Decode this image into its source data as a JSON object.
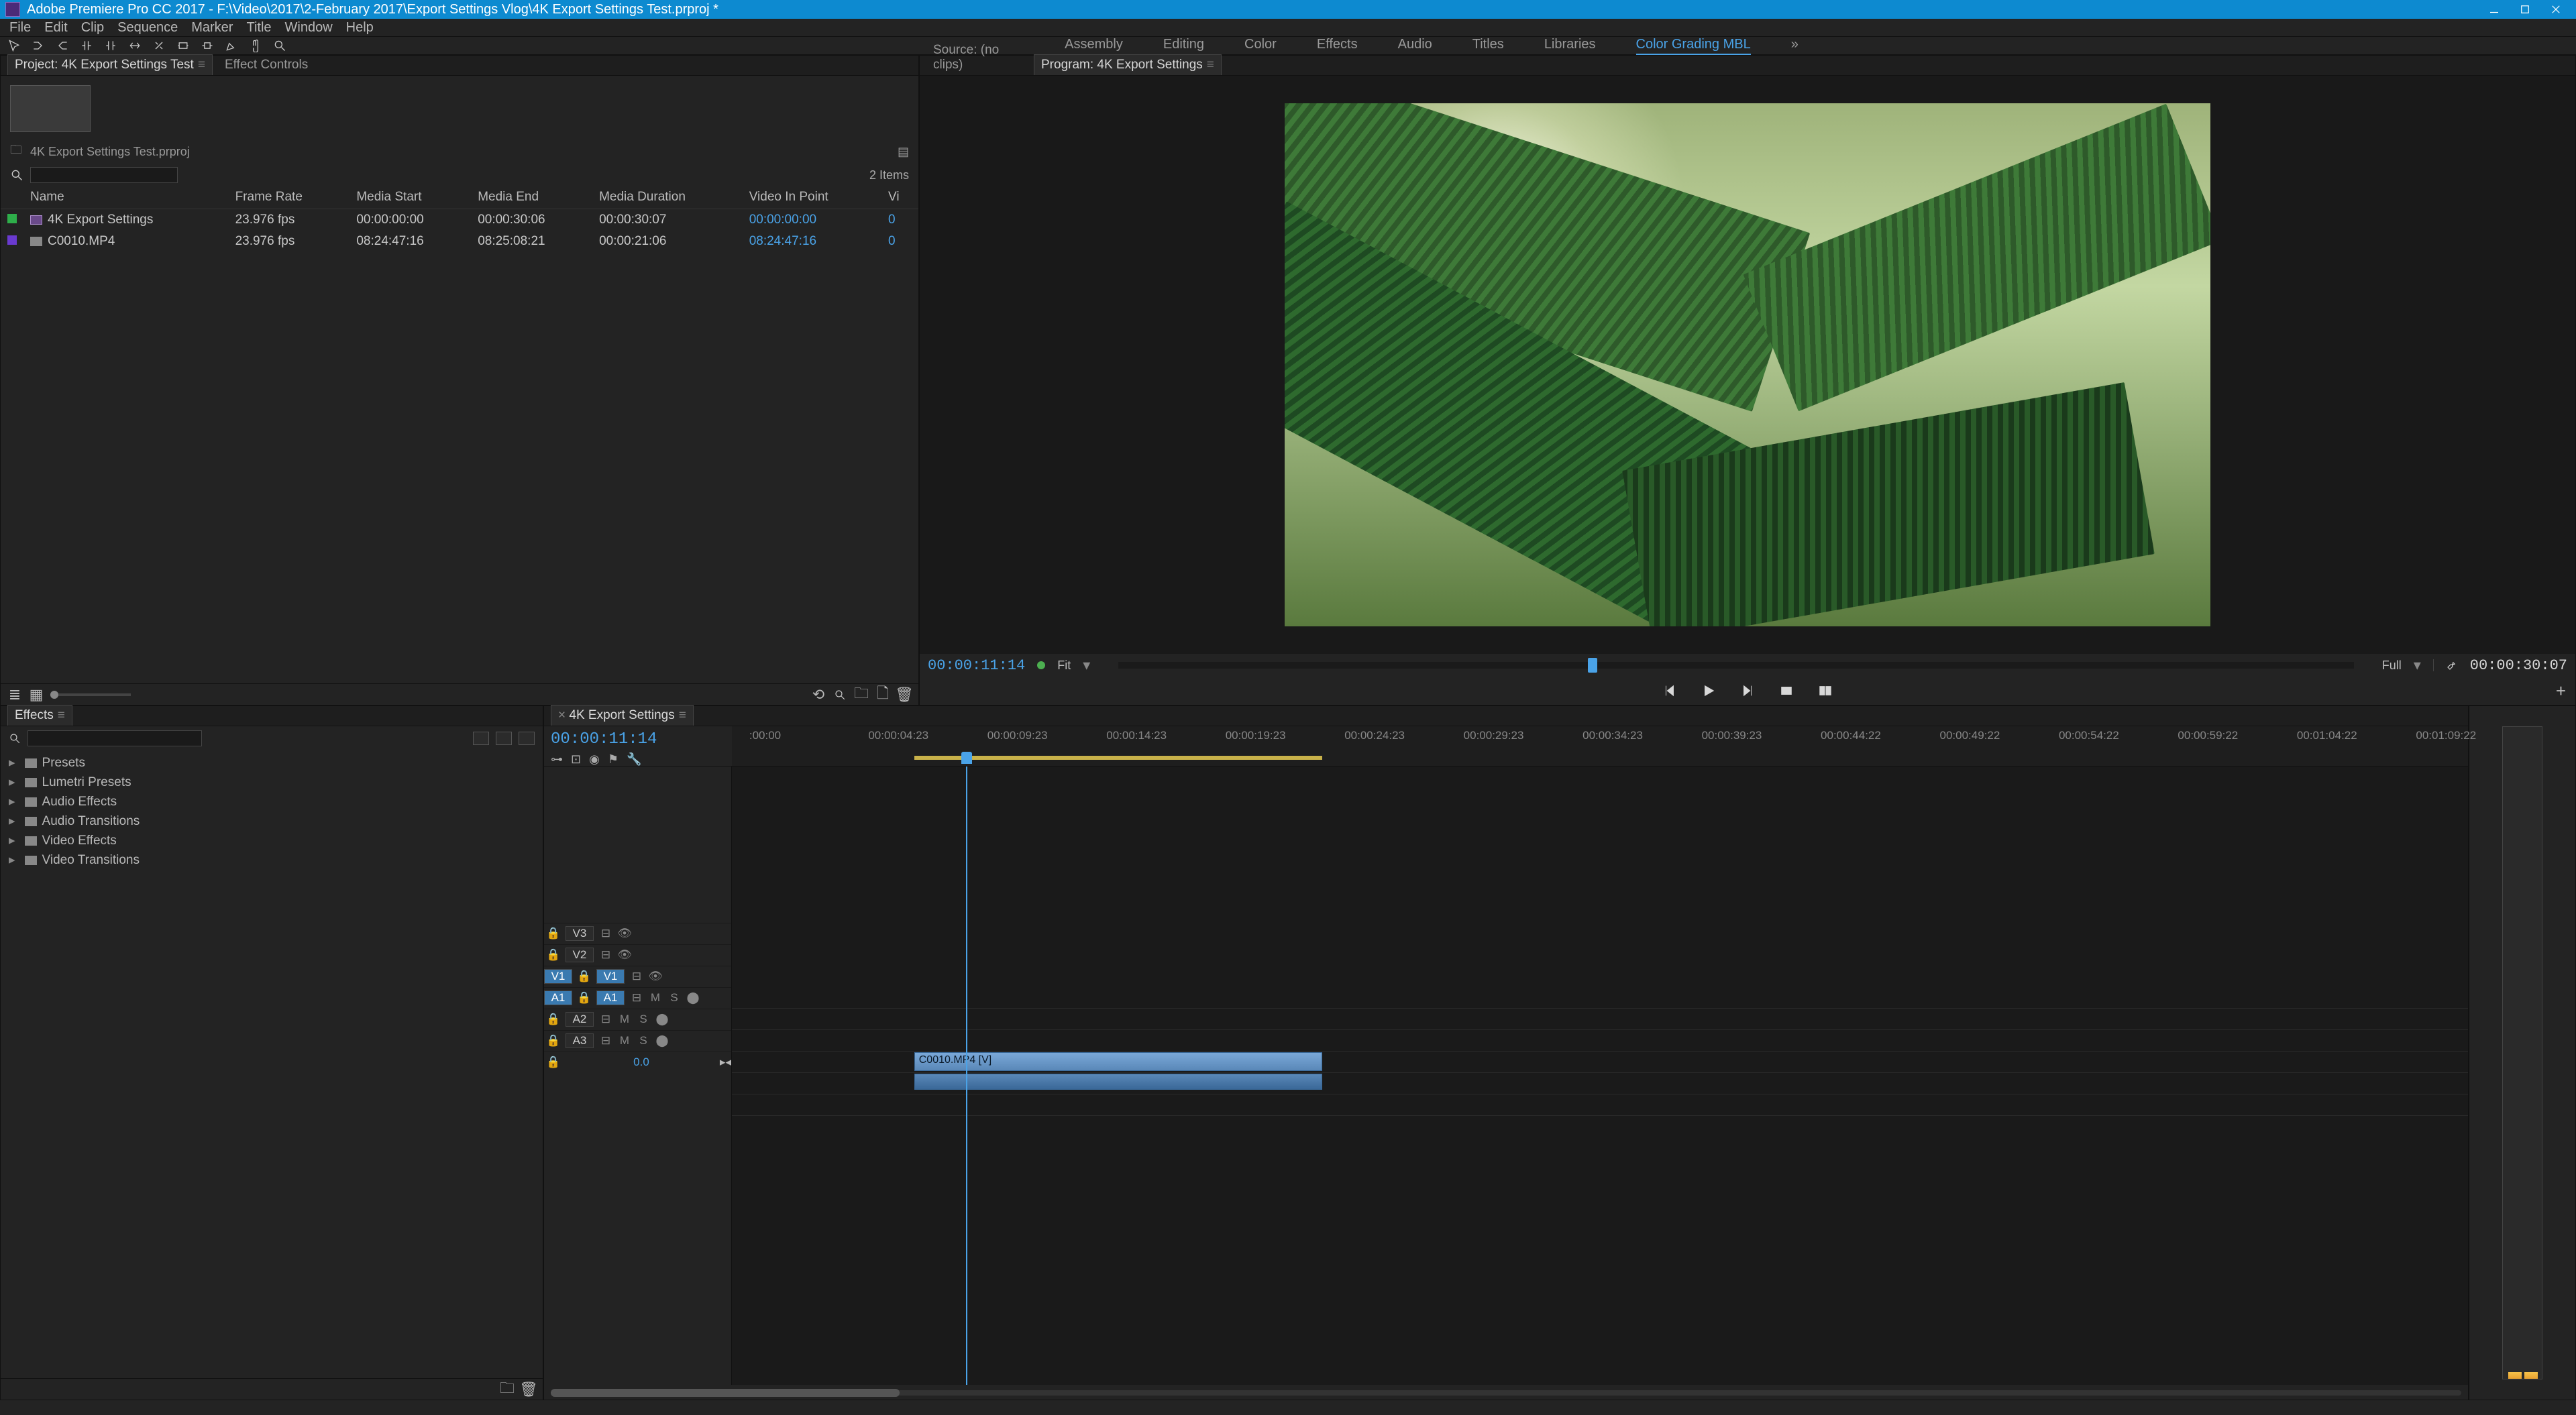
{
  "titlebar": {
    "text": "Adobe Premiere Pro CC 2017 - F:\\Video\\2017\\2-February 2017\\Export Settings Vlog\\4K Export Settings Test.prproj *"
  },
  "menu": [
    "File",
    "Edit",
    "Clip",
    "Sequence",
    "Marker",
    "Title",
    "Window",
    "Help"
  ],
  "workspaces": {
    "items": [
      "Assembly",
      "Editing",
      "Color",
      "Effects",
      "Audio",
      "Titles",
      "Libraries",
      "Color Grading MBL"
    ],
    "active": "Color Grading MBL",
    "chevron": "»"
  },
  "project": {
    "tab_project": "Project: 4K Export Settings Test",
    "tab_effectcontrols": "Effect Controls",
    "bin_label": "4K Export Settings Test.prproj",
    "items_count": "2 Items",
    "search_placeholder": "",
    "columns": [
      "Name",
      "Frame Rate",
      "Media Start",
      "Media End",
      "Media Duration",
      "Video In Point",
      "Vi"
    ],
    "rows": [
      {
        "color": "#2eae4a",
        "icon": "seq",
        "name": "4K Export Settings",
        "frame_rate": "23.976 fps",
        "media_start": "00:00:00:00",
        "media_end": "00:00:30:06",
        "media_duration": "00:00:30:07",
        "video_in": "00:00:00:00",
        "video_in_tail": "0"
      },
      {
        "color": "#6a3ad0",
        "icon": "clip",
        "name": "C0010.MP4",
        "frame_rate": "23.976 fps",
        "media_start": "08:24:47:16",
        "media_end": "08:25:08:21",
        "media_duration": "00:00:21:06",
        "video_in": "08:24:47:16",
        "video_in_tail": "0"
      }
    ]
  },
  "monitors": {
    "source_tab": "Source: (no clips)",
    "program_tab": "Program: 4K Export Settings",
    "program_timecode": "00:00:11:14",
    "program_duration": "00:00:30:07",
    "fit_label": "Fit",
    "full_label": "Full",
    "playhead_percent": 38
  },
  "effects": {
    "tab_label": "Effects",
    "search_placeholder": "",
    "folders": [
      "Presets",
      "Lumetri Presets",
      "Audio Effects",
      "Audio Transitions",
      "Video Effects",
      "Video Transitions"
    ]
  },
  "timeline": {
    "seq_tab": "4K Export Settings",
    "timecode": "00:00:11:14",
    "ruler_ticks": [
      ":00:00",
      "00:00:04:23",
      "00:00:09:23",
      "00:00:14:23",
      "00:00:19:23",
      "00:00:24:23",
      "00:00:29:23",
      "00:00:34:23",
      "00:00:39:23",
      "00:00:44:22",
      "00:00:49:22",
      "00:00:54:22",
      "00:00:59:22",
      "00:01:04:22",
      "00:01:09:22"
    ],
    "duration_frames_total": "01:09:22",
    "work_area_start_pct": 10.5,
    "work_area_width_pct": 23.5,
    "playhead_pct": 13.5,
    "tracks_video": [
      "V3",
      "V2",
      "V1"
    ],
    "tracks_audio": [
      "A1",
      "A2",
      "A3"
    ],
    "target_video": "V1",
    "target_audio": "A1",
    "clip_label": "C0010.MP4 [V]",
    "clip_start_pct": 10.5,
    "clip_width_pct": 23.5,
    "master_label": "0.0"
  },
  "status": {
    "left": ""
  }
}
